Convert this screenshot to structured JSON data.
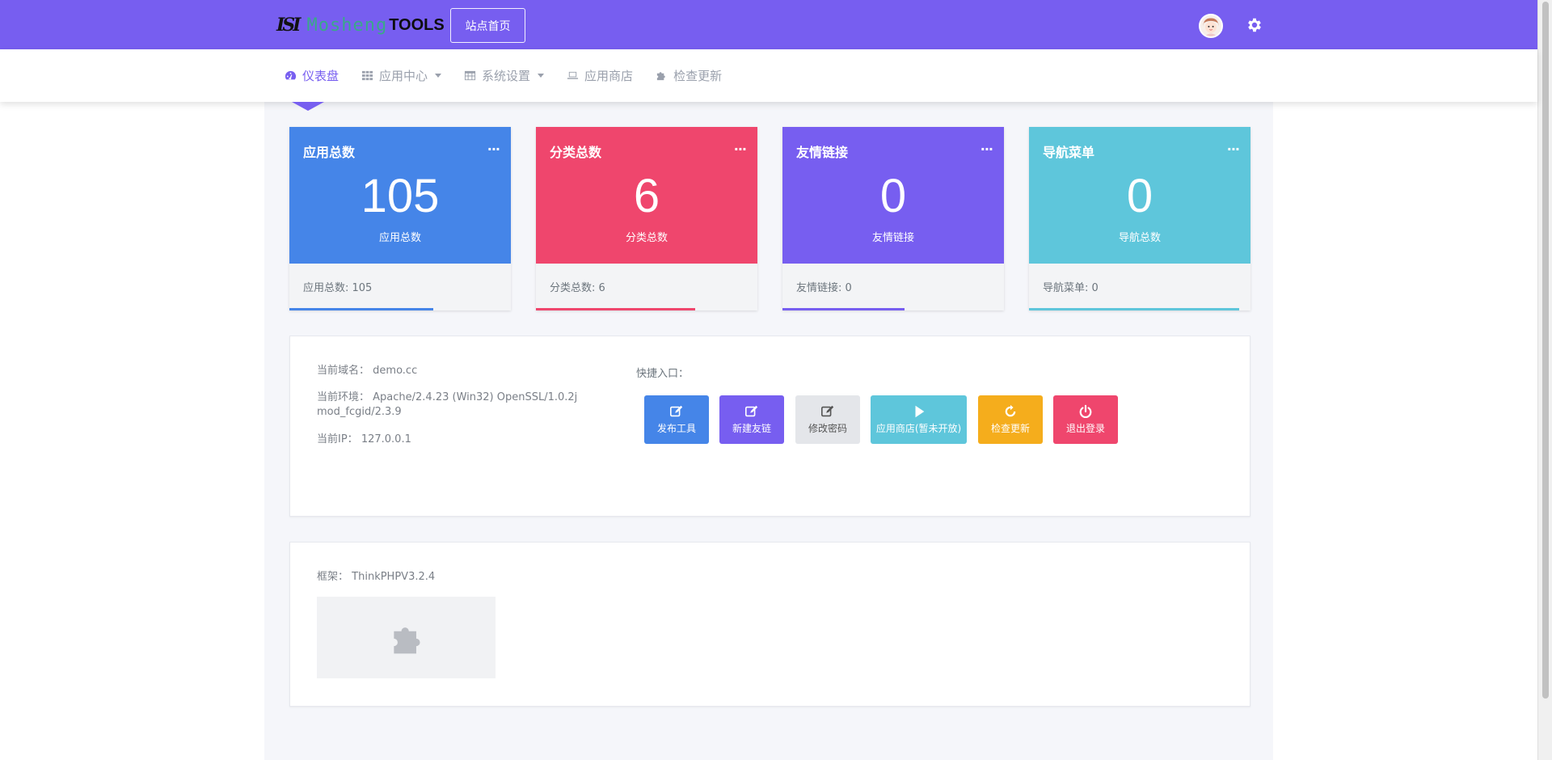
{
  "header": {
    "logo_mark": "ISI",
    "logo_script": "Mosheng",
    "logo_tools": "TOOLS",
    "site_home_label": "站点首页",
    "accent": "#775ef0"
  },
  "nav": {
    "items": [
      {
        "label": "仪表盘",
        "icon": "dashboard-icon"
      },
      {
        "label": "应用中心",
        "icon": "grid-icon"
      },
      {
        "label": "系统设置",
        "icon": "table-icon"
      },
      {
        "label": "应用商店",
        "icon": "laptop-icon"
      },
      {
        "label": "检查更新",
        "icon": "puzzle-icon"
      }
    ]
  },
  "cards": [
    {
      "title": "应用总数",
      "value": "105",
      "sub": "应用总数",
      "foot": "应用总数:  105",
      "color": "#4585e8",
      "bar_fraction": 0.65
    },
    {
      "title": "分类总数",
      "value": "6",
      "sub": "分类总数",
      "foot": "分类总数:  6",
      "color": "#ef466d",
      "bar_fraction": 0.72
    },
    {
      "title": "友情链接",
      "value": "0",
      "sub": "友情链接",
      "foot": "友情链接:  0",
      "color": "#775ef0",
      "bar_fraction": 0.55
    },
    {
      "title": "导航菜单",
      "value": "0",
      "sub": "导航总数",
      "foot": "导航菜单:  0",
      "color": "#5ec6db",
      "bar_fraction": 0.95
    }
  ],
  "card_more": "...",
  "info": {
    "domain_label": "当前域名：",
    "domain_value": "demo.cc",
    "env_label": "当前环境：",
    "env_value_1": "Apache/2.4.23 (Win32) OpenSSL/1.0.2j",
    "env_value_2": "mod_fcgid/2.3.9",
    "ip_label": "当前IP：",
    "ip_value": "127.0.0.1",
    "quick_label": "快捷入口："
  },
  "quick": [
    {
      "label": "发布工具",
      "icon": "edit-icon",
      "color": "#4585e8",
      "text_color": "#ffffff"
    },
    {
      "label": "新建友链",
      "icon": "edit-icon",
      "color": "#775ef0",
      "text_color": "#ffffff"
    },
    {
      "label": "修改密码",
      "icon": "edit-icon",
      "color": "#e4e6ea",
      "text_color": "#555555"
    },
    {
      "label": "应用商店(暂未开放)",
      "icon": "play-icon",
      "color": "#5ec6db",
      "text_color": "#ffffff"
    },
    {
      "label": "检查更新",
      "icon": "refresh-icon",
      "color": "#f5ad1c",
      "text_color": "#ffffff"
    },
    {
      "label": "退出登录",
      "icon": "power-icon",
      "color": "#ef466d",
      "text_color": "#ffffff"
    }
  ],
  "framework": {
    "label": "框架：",
    "value": "ThinkPHPV3.2.4"
  }
}
